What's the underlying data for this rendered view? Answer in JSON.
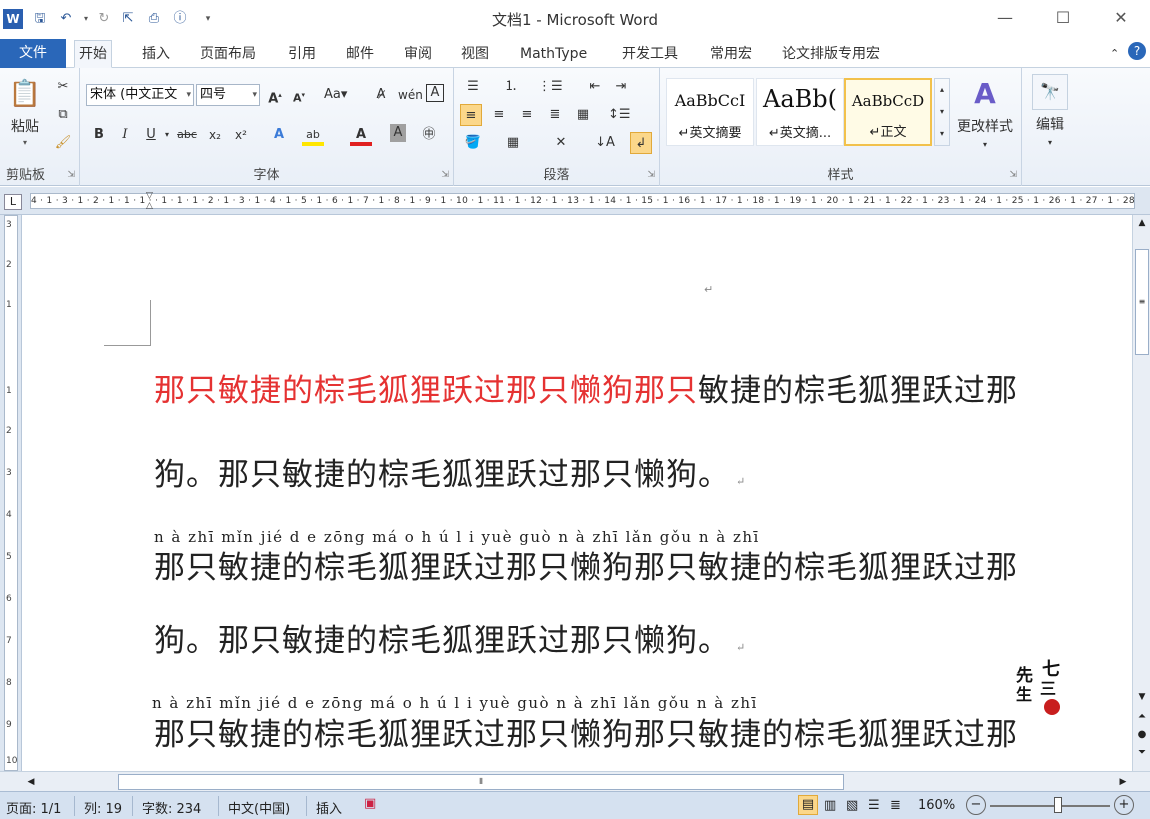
{
  "window": {
    "title": "文档1 - Microsoft Word",
    "minimize": "—",
    "maximize": "☐",
    "close": "✕"
  },
  "tabs": [
    "文件",
    "开始",
    "插入",
    "页面布局",
    "引用",
    "邮件",
    "审阅",
    "视图",
    "MathType",
    "开发工具",
    "常用宏",
    "论文排版专用宏"
  ],
  "ribbon": {
    "clipboard": {
      "label": "剪贴板",
      "paste": "粘贴"
    },
    "font": {
      "label": "字体",
      "font_name": "宋体 (中文正文",
      "font_size": "四号",
      "font_color": "#e02020"
    },
    "paragraph": {
      "label": "段落"
    },
    "styles": {
      "label": "样式",
      "items": [
        {
          "sample": "AaBbCcI",
          "name": "↵英文摘要"
        },
        {
          "sample": "AaBb(",
          "name": "↵英文摘..."
        },
        {
          "sample": "AaBbCcD",
          "name": "↵正文"
        }
      ],
      "change_styles": "更改样式"
    },
    "editing": {
      "label": "编辑"
    }
  },
  "ruler": {
    "h_marks": "4 · 1 · 3 · 1 · 2 · 1 · 1 · 1 ·   · 1 · 1 · 1 · 2 · 1 · 3 · 1 · 4 · 1 · 5 · 1 · 6 · 1 · 7 · 1 · 8 · 1 · 9 · 1 · 10 · 1 · 11 · 1 · 12 · 1 · 13 · 1 · 14 · 1 · 15 · 1 · 16 · 1 · 17 · 1 · 18 · 1 · 19 · 1 · 20 · 1 · 21 · 1 · 22 · 1 · 23 · 1 · 24 · 1 · 25 · 1 · 26 · 1 · 27 · 1 · 28 · 1 · 29 · 1 · 30 · 1 · 31 · 1 · 32 · 1 · 33 · 1 · 34 · 1",
    "v_marks": [
      "3",
      "2",
      "1",
      "1",
      "2",
      "3",
      "4",
      "5",
      "6",
      "7",
      "8",
      "9",
      "10"
    ]
  },
  "document": {
    "line1_red": "那只敏捷的棕毛狐狸跃过那只懒狗那只",
    "line1_black": "敏捷的棕毛狐狸跃过那",
    "line2": "狗。那只敏捷的棕毛狐狸跃过那只懒狗。",
    "pinyin1": "n à zhī mǐn jié d e zōng má o h ú l i yuè guò n à zhī lǎn gǒu n à zhī",
    "line3": "那只敏捷的棕毛狐狸跃过那只懒狗那只敏捷的棕毛狐狸跃过那",
    "line4": "狗。那只敏捷的棕毛狐狸跃过那只懒狗。",
    "pinyin2": "n  à zhī mǐn jié d  e zōng má o h   ú l   i yuè guò n   à zhī lǎn gǒu n   à zhī",
    "line5": "那只敏捷的棕毛狐狸跃过那只懒狗那只敏捷的棕毛狐狸跃过那",
    "para_mark": "↵",
    "watermark": [
      "七",
      "先",
      "三",
      "生"
    ]
  },
  "status": {
    "page": "页面: 1/1",
    "column": "列: 19",
    "words": "字数: 234",
    "language": "中文(中国)",
    "mode": "插入",
    "zoom": "160%"
  }
}
